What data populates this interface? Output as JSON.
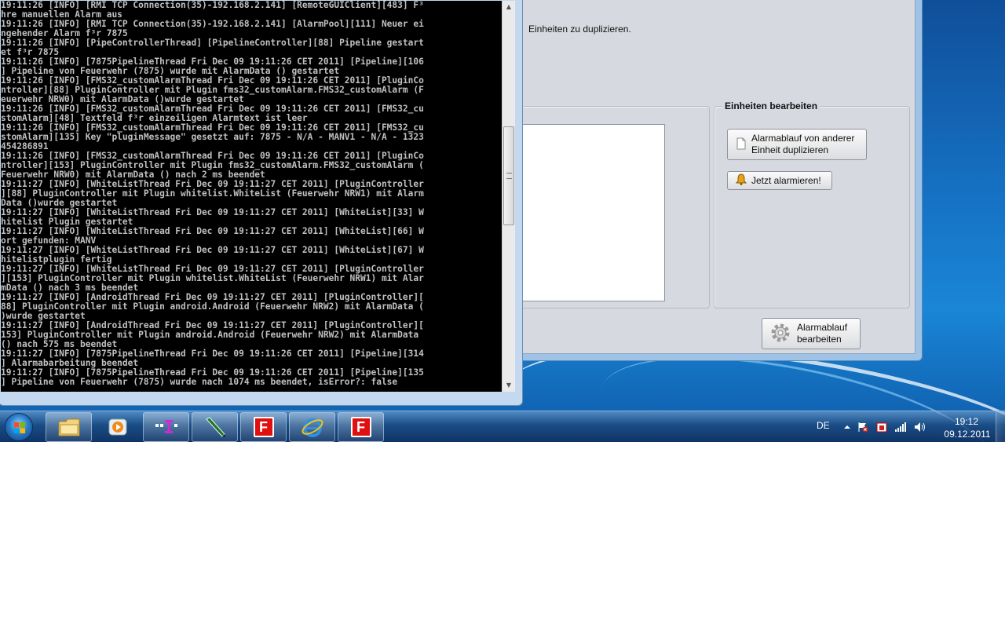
{
  "app": {
    "hint_text": "Einheiten zu duplizieren.",
    "units_group_title": "Einheiten bearbeiten",
    "duplicate_button": "Alarmablauf von anderer\nEinheit duplizieren",
    "alarm_now_button": "Jetzt alarmieren!",
    "edit_alarm_button": "Alarmablauf\nbearbeiten"
  },
  "console": {
    "lines": [
      "19:11:26 [INFO] [RMI TCP Connection(35)-192.168.2.141] [RemoteGUIClient][483] F³",
      "hre manuellen Alarm aus",
      "19:11:26 [INFO] [RMI TCP Connection(35)-192.168.2.141] [AlarmPool][111] Neuer ei",
      "ngehender Alarm f³r 7875",
      "19:11:26 [INFO] [PipeControllerThread] [PipelineController][88] Pipeline gestart",
      "et f³r 7875",
      "19:11:26 [INFO] [7875PipelineThread Fri Dec 09 19:11:26 CET 2011] [Pipeline][106",
      "] Pipeline von Feuerwehr (7875) wurde mit AlarmData () gestartet",
      "19:11:26 [INFO] [FMS32_customAlarmThread Fri Dec 09 19:11:26 CET 2011] [PluginCo",
      "ntroller][88] PluginController mit Plugin fms32_customAlarm.FMS32_customAlarm (F",
      "euerwehr NRW0) mit AlarmData ()wurde gestartet",
      "19:11:26 [INFO] [FMS32_customAlarmThread Fri Dec 09 19:11:26 CET 2011] [FMS32_cu",
      "stomAlarm][48] Textfeld f³r einzeiligen Alarmtext ist leer",
      "19:11:26 [INFO] [FMS32_customAlarmThread Fri Dec 09 19:11:26 CET 2011] [FMS32_cu",
      "stomAlarm][135] Key \"pluginMessage\" gesetzt auf: 7875 - N/A - MANV1 - N/A - 1323",
      "454286891",
      "19:11:26 [INFO] [FMS32_customAlarmThread Fri Dec 09 19:11:26 CET 2011] [PluginCo",
      "ntroller][153] PluginController mit Plugin fms32_customAlarm.FMS32_customAlarm (",
      "Feuerwehr NRW0) mit AlarmData () nach 2 ms beendet",
      "19:11:27 [INFO] [WhiteListThread Fri Dec 09 19:11:27 CET 2011] [PluginController",
      "][88] PluginController mit Plugin whitelist.WhiteList (Feuerwehr NRW1) mit Alarm",
      "Data ()wurde gestartet",
      "19:11:27 [INFO] [WhiteListThread Fri Dec 09 19:11:27 CET 2011] [WhiteList][33] W",
      "hitelist Plugin gestartet",
      "19:11:27 [INFO] [WhiteListThread Fri Dec 09 19:11:27 CET 2011] [WhiteList][66] W",
      "ort gefunden: MANV",
      "19:11:27 [INFO] [WhiteListThread Fri Dec 09 19:11:27 CET 2011] [WhiteList][67] W",
      "hitelistplugin fertig",
      "19:11:27 [INFO] [WhiteListThread Fri Dec 09 19:11:27 CET 2011] [PluginController",
      "][153] PluginController mit Plugin whitelist.WhiteList (Feuerwehr NRW1) mit Alar",
      "mData () nach 3 ms beendet",
      "19:11:27 [INFO] [AndroidThread Fri Dec 09 19:11:27 CET 2011] [PluginController][",
      "88] PluginController mit Plugin android.Android (Feuerwehr NRW2) mit AlarmData (",
      ")wurde gestartet",
      "19:11:27 [INFO] [AndroidThread Fri Dec 09 19:11:27 CET 2011] [PluginController][",
      "153] PluginController mit Plugin android.Android (Feuerwehr NRW2) mit AlarmData",
      "() nach 575 ms beendet",
      "19:11:27 [INFO] [7875PipelineThread Fri Dec 09 19:11:26 CET 2011] [Pipeline][314",
      "] Alarmabarbeitung beendet",
      "19:11:27 [INFO] [7875PipelineThread Fri Dec 09 19:11:26 CET 2011] [Pipeline][135",
      "] Pipeline von Feuerwehr (7875) wurde nach 1074 ms beendet, isError?: false"
    ]
  },
  "taskbar": {
    "items": [
      {
        "name": "windows-explorer",
        "icon": "folder-icon",
        "active": true
      },
      {
        "name": "media-player",
        "icon": "media-player-icon",
        "active": false
      },
      {
        "name": "app-purple",
        "icon": "pipeline-app-icon",
        "active": true
      },
      {
        "name": "app-pen",
        "icon": "pen-tool-icon",
        "active": true
      },
      {
        "name": "app-f-1",
        "icon": "f-app-icon",
        "active": true
      },
      {
        "name": "internet-explorer",
        "icon": "internet-explorer-icon",
        "active": true
      },
      {
        "name": "app-f-2",
        "icon": "f-app-icon",
        "active": true
      }
    ],
    "f_letter": "F",
    "language": "DE",
    "time": "19:12",
    "date": "09.12.2011"
  }
}
